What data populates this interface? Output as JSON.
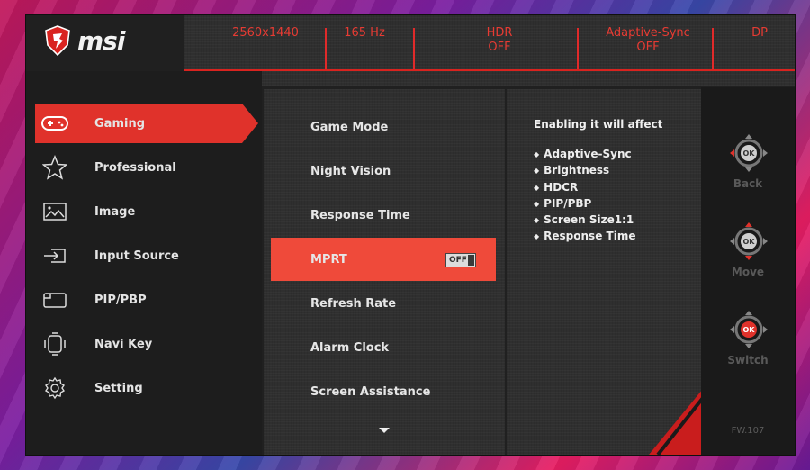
{
  "brand": {
    "logo_text": "msi",
    "logo_color": "#d9231f"
  },
  "header": {
    "resolution": "2560x1440",
    "refresh": "165 Hz",
    "hdr_label": "HDR",
    "hdr_value": "OFF",
    "adaptive_sync_label": "Adaptive-Sync",
    "adaptive_sync_value": "OFF",
    "input": "DP"
  },
  "nav": {
    "items": [
      {
        "label": "Gaming",
        "icon": "gamepad-icon",
        "active": true
      },
      {
        "label": "Professional",
        "icon": "star-icon",
        "active": false
      },
      {
        "label": "Image",
        "icon": "image-icon",
        "active": false
      },
      {
        "label": "Input Source",
        "icon": "input-source-icon",
        "active": false
      },
      {
        "label": "PIP/PBP",
        "icon": "pip-icon",
        "active": false
      },
      {
        "label": "Navi Key",
        "icon": "navi-key-icon",
        "active": false
      },
      {
        "label": "Setting",
        "icon": "gear-icon",
        "active": false
      }
    ]
  },
  "menu": {
    "items": [
      {
        "label": "Game Mode"
      },
      {
        "label": "Night Vision"
      },
      {
        "label": "Response Time"
      },
      {
        "label": "MPRT",
        "active": true,
        "toggle": "OFF"
      },
      {
        "label": "Refresh Rate"
      },
      {
        "label": "Alarm Clock"
      },
      {
        "label": "Screen Assistance"
      }
    ],
    "more_icon": "triangle-down-icon"
  },
  "info": {
    "title": "Enabling it will affect",
    "items": [
      "Adaptive-Sync",
      "Brightness",
      "HDCR",
      "PIP/PBP",
      "Screen Size1:1",
      "Response Time"
    ]
  },
  "controls": {
    "back_label": "Back",
    "move_label": "Move",
    "switch_label": "Switch",
    "ok_label": "OK",
    "firmware": "FW.107"
  },
  "colors": {
    "accent": "#e0322b",
    "highlight": "#ef4a3a",
    "panel": "#2f2f2f"
  }
}
